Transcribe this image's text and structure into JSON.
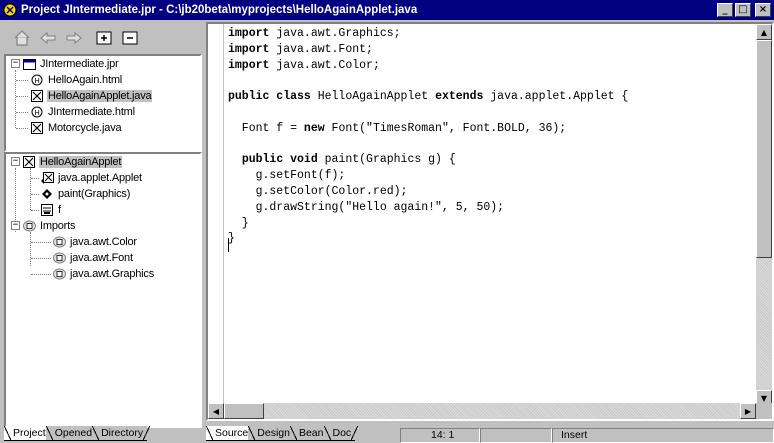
{
  "window": {
    "title": "Project JIntermediate.jpr - C:\\jb20beta\\myprojects\\HelloAgainApplet.java",
    "minimize": "_",
    "maximize": "□",
    "close": "×"
  },
  "toolbar": {
    "home_icon": "home-icon",
    "back_icon": "back-arrow-icon",
    "forward_icon": "forward-arrow-icon",
    "add_icon": "add-file-icon",
    "remove_icon": "remove-file-icon"
  },
  "project_tree": {
    "root": "JIntermediate.jpr",
    "items": [
      {
        "label": "HelloAgain.html",
        "icon": "html-file-icon"
      },
      {
        "label": "HelloAgainApplet.java",
        "icon": "java-file-icon",
        "selected": true
      },
      {
        "label": "JIntermediate.html",
        "icon": "html-file-icon"
      },
      {
        "label": "Motorcycle.java",
        "icon": "java-file-icon"
      }
    ]
  },
  "structure_tree": {
    "root": "HelloAgainApplet",
    "members": [
      {
        "label": "java.applet.Applet",
        "icon": "superclass-icon"
      },
      {
        "label": "paint(Graphics)",
        "icon": "method-icon"
      },
      {
        "label": "f",
        "icon": "field-icon"
      }
    ],
    "imports_label": "Imports",
    "imports": [
      {
        "label": "java.awt.Color"
      },
      {
        "label": "java.awt.Font"
      },
      {
        "label": "java.awt.Graphics"
      }
    ]
  },
  "left_tabs": [
    "Project",
    "Opened",
    "Directory"
  ],
  "editor_tabs": [
    "Source",
    "Design",
    "Bean",
    "Doc"
  ],
  "code_lines": [
    [
      {
        "kw": "import"
      },
      {
        "t": " java.awt.Graphics;"
      }
    ],
    [
      {
        "kw": "import"
      },
      {
        "t": " java.awt.Font;"
      }
    ],
    [
      {
        "kw": "import"
      },
      {
        "t": " java.awt.Color;"
      }
    ],
    [],
    [
      {
        "kw": "public class"
      },
      {
        "t": " HelloAgainApplet "
      },
      {
        "kw": "extends"
      },
      {
        "t": " java.applet.Applet {"
      }
    ],
    [],
    [
      {
        "t": "  Font f = "
      },
      {
        "kw": "new"
      },
      {
        "t": " Font(\"TimesRoman\", Font.BOLD, 36);"
      }
    ],
    [],
    [
      {
        "t": "  "
      },
      {
        "kw": "public void"
      },
      {
        "t": " paint(Graphics g) {"
      }
    ],
    [
      {
        "t": "    g.setFont(f);"
      }
    ],
    [
      {
        "t": "    g.setColor(Color.red);"
      }
    ],
    [
      {
        "t": "    g.drawString(\"Hello again!\", 5, 50);"
      }
    ],
    [
      {
        "t": "  }"
      }
    ],
    [
      {
        "t": "}"
      }
    ]
  ],
  "status": {
    "position": "14:  1",
    "mode": "Insert"
  }
}
